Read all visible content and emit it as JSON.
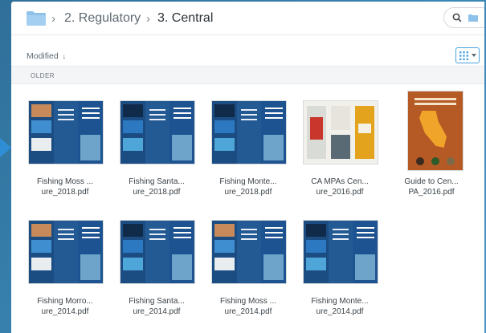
{
  "breadcrumb": {
    "separator": "›",
    "items": [
      {
        "label": "2. Regulatory"
      },
      {
        "label": "3. Central"
      }
    ]
  },
  "sort": {
    "label": "Modified",
    "arrow": "↓"
  },
  "section": {
    "label": "OLDER"
  },
  "colors": {
    "accent": "#2f8fd6",
    "folder": "#8fc2ea",
    "brochure_blue": "#1b4c82"
  },
  "icons": {
    "folder": "folder-icon",
    "search": "search-icon",
    "view": "grid-view-icon"
  },
  "files": [
    {
      "line1": "Fishing Moss ...",
      "line2": "ure_2018.pdf",
      "thumb": "brochure"
    },
    {
      "line1": "Fishing Santa...",
      "line2": "ure_2018.pdf",
      "thumb": "brochure"
    },
    {
      "line1": "Fishing Monte...",
      "line2": "ure_2018.pdf",
      "thumb": "brochure"
    },
    {
      "line1": "CA MPAs Cen...",
      "line2": "ure_2016.pdf",
      "thumb": "map"
    },
    {
      "line1": "Guide to Cen...",
      "line2": "PA_2016.pdf",
      "thumb": "guide"
    },
    {
      "line1": "Fishing Morro...",
      "line2": "ure_2014.pdf",
      "thumb": "brochure"
    },
    {
      "line1": "Fishing Santa...",
      "line2": "ure_2014.pdf",
      "thumb": "brochure"
    },
    {
      "line1": "Fishing Moss ...",
      "line2": "ure_2014.pdf",
      "thumb": "brochure"
    },
    {
      "line1": "Fishing Monte...",
      "line2": "ure_2014.pdf",
      "thumb": "brochure"
    }
  ]
}
